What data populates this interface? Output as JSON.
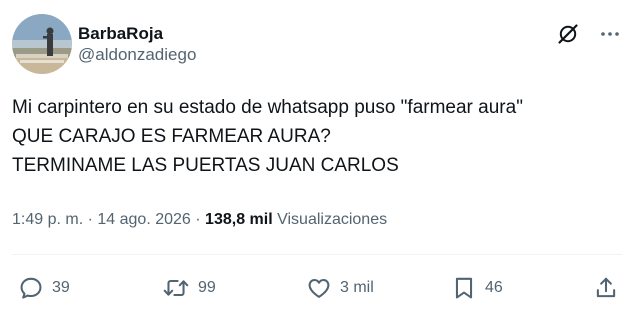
{
  "author": {
    "display_name": "BarbaRoja",
    "handle": "@aldonzadiego"
  },
  "header_icons": {
    "grok": "grok-icon",
    "more": "more-options-icon"
  },
  "tweet": {
    "lines": [
      "Mi carpintero en su estado de whatsapp puso \"farmear aura\"",
      "QUE CARAJO ES FARMEAR AURA?",
      "TERMINAME LAS PUERTAS JUAN CARLOS"
    ]
  },
  "meta": {
    "time": "1:49 p. m.",
    "separator": "·",
    "date": "14 ago. 2026",
    "views_count": "138,8 mil",
    "views_label": "Visualizaciones"
  },
  "actions": {
    "replies": "39",
    "reposts": "99",
    "likes": "3 mil",
    "bookmarks": "46"
  },
  "colors": {
    "text_primary": "#0f1419",
    "text_secondary": "#536471",
    "divider": "#eff3f4"
  }
}
